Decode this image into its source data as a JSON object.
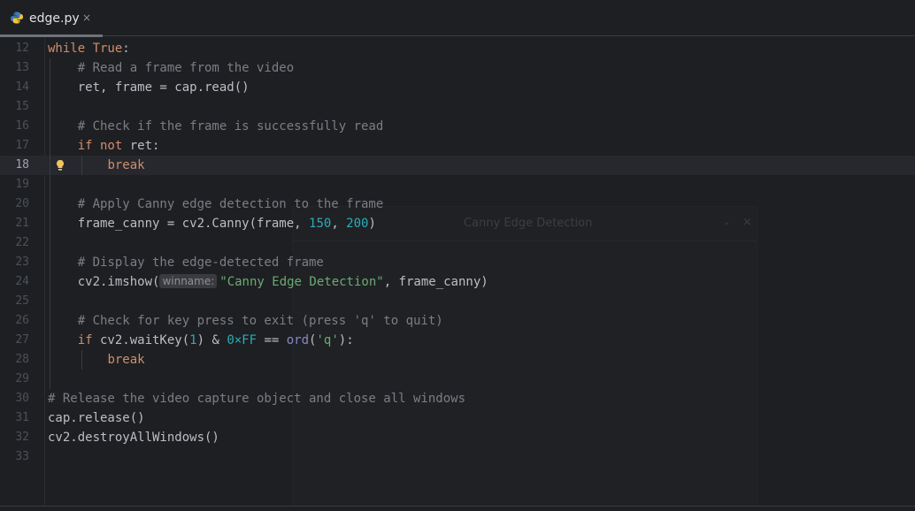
{
  "tab": {
    "filename": "edge.py",
    "close_glyph": "×",
    "icon": "python-file-icon"
  },
  "popup": {
    "title": "Canny Edge Detection",
    "chevron": "⌄",
    "close": "×"
  },
  "editor": {
    "current_line": 18,
    "lines": [
      {
        "n": "12",
        "tokens": [
          {
            "t": "while ",
            "c": "kw"
          },
          {
            "t": "True",
            "c": "kw"
          },
          {
            "t": ":",
            "c": "op"
          }
        ]
      },
      {
        "n": "13",
        "tokens": [
          {
            "t": "    # Read a frame from the video",
            "c": "cm"
          }
        ]
      },
      {
        "n": "14",
        "tokens": [
          {
            "t": "    ret, frame = cap.read()",
            "c": "op"
          }
        ]
      },
      {
        "n": "15",
        "tokens": []
      },
      {
        "n": "16",
        "tokens": [
          {
            "t": "    # Check if the frame is successfully read",
            "c": "cm"
          }
        ]
      },
      {
        "n": "17",
        "tokens": [
          {
            "t": "    ",
            "c": "op"
          },
          {
            "t": "if not",
            "c": "kw"
          },
          {
            "t": " ret:",
            "c": "op"
          }
        ]
      },
      {
        "n": "18",
        "tokens": [
          {
            "t": "        ",
            "c": "op"
          },
          {
            "t": "break",
            "c": "kw"
          }
        ]
      },
      {
        "n": "19",
        "tokens": []
      },
      {
        "n": "20",
        "tokens": [
          {
            "t": "    # Apply Canny edge detection to the frame",
            "c": "cm"
          }
        ]
      },
      {
        "n": "21",
        "tokens": [
          {
            "t": "    frame_canny = cv2.Canny(frame, ",
            "c": "op"
          },
          {
            "t": "150",
            "c": "num"
          },
          {
            "t": ", ",
            "c": "op"
          },
          {
            "t": "200",
            "c": "num"
          },
          {
            "t": ")",
            "c": "op"
          }
        ]
      },
      {
        "n": "22",
        "tokens": []
      },
      {
        "n": "23",
        "tokens": [
          {
            "t": "    # Display the edge-detected frame",
            "c": "cm"
          }
        ]
      },
      {
        "n": "24",
        "tokens": [
          {
            "t": "    cv2.imshow(",
            "c": "op"
          },
          {
            "t": "winname:",
            "c": "hint"
          },
          {
            "t": "\"Canny Edge Detection\"",
            "c": "str"
          },
          {
            "t": ", frame_canny)",
            "c": "op"
          }
        ]
      },
      {
        "n": "25",
        "tokens": []
      },
      {
        "n": "26",
        "tokens": [
          {
            "t": "    # Check for key press to exit (press 'q' to quit)",
            "c": "cm"
          }
        ]
      },
      {
        "n": "27",
        "tokens": [
          {
            "t": "    ",
            "c": "op"
          },
          {
            "t": "if",
            "c": "kw"
          },
          {
            "t": " cv2.waitKey(",
            "c": "op"
          },
          {
            "t": "1",
            "c": "num"
          },
          {
            "t": ") & ",
            "c": "op"
          },
          {
            "t": "0×FF",
            "c": "num"
          },
          {
            "t": " == ",
            "c": "op"
          },
          {
            "t": "ord",
            "c": "fn-ord"
          },
          {
            "t": "(",
            "c": "op"
          },
          {
            "t": "'q'",
            "c": "str"
          },
          {
            "t": "):",
            "c": "op"
          }
        ]
      },
      {
        "n": "28",
        "tokens": [
          {
            "t": "        ",
            "c": "op"
          },
          {
            "t": "break",
            "c": "kw"
          }
        ]
      },
      {
        "n": "29",
        "tokens": []
      },
      {
        "n": "30",
        "tokens": [
          {
            "t": "# Release the video capture object and close all windows",
            "c": "cm"
          }
        ]
      },
      {
        "n": "31",
        "tokens": [
          {
            "t": "cap.release()",
            "c": "op"
          }
        ]
      },
      {
        "n": "32",
        "tokens": [
          {
            "t": "cv2.destroyAllWindows()",
            "c": "op"
          }
        ]
      },
      {
        "n": "33",
        "tokens": []
      }
    ]
  },
  "colors": {
    "background": "#1e1f22",
    "keyword": "#cf8e6d",
    "comment": "#7a7e85",
    "number": "#2aacb8",
    "string": "#6aab73",
    "builtin": "#8888c6",
    "text": "#bcbec4"
  }
}
